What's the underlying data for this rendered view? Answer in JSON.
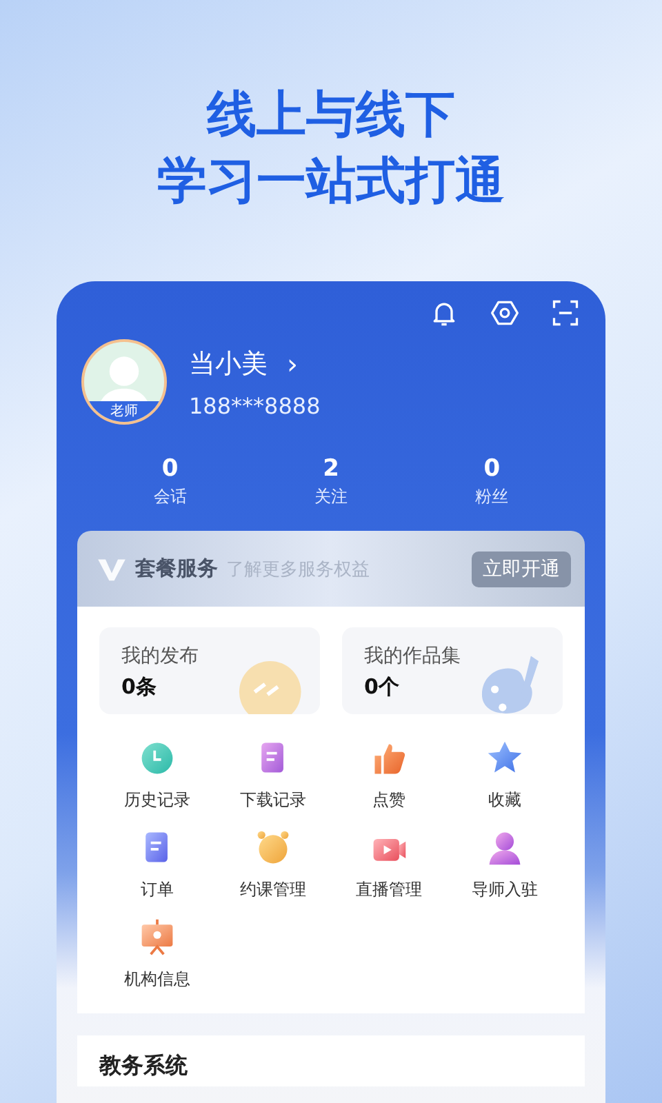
{
  "headline": [
    "线上与线下",
    "学习一站式打通"
  ],
  "profile": {
    "name": "当小美",
    "chevron": "›",
    "phone": "188***8888",
    "role_badge": "老师"
  },
  "stats": [
    {
      "value": "0",
      "label": "会话"
    },
    {
      "value": "2",
      "label": "关注"
    },
    {
      "value": "0",
      "label": "粉丝"
    }
  ],
  "membership": {
    "title": "套餐服务",
    "subtitle": "了解更多服务权益",
    "button": "立即开通"
  },
  "my_cards": [
    {
      "title": "我的发布",
      "count": "0条"
    },
    {
      "title": "我的作品集",
      "count": "0个"
    }
  ],
  "features": [
    {
      "label": "历史记录"
    },
    {
      "label": "下载记录"
    },
    {
      "label": "点赞"
    },
    {
      "label": "收藏"
    },
    {
      "label": "订单"
    },
    {
      "label": "约课管理"
    },
    {
      "label": "直播管理"
    },
    {
      "label": "导师入驻"
    },
    {
      "label": "机构信息"
    }
  ],
  "next_section": {
    "title": "教务系统"
  }
}
